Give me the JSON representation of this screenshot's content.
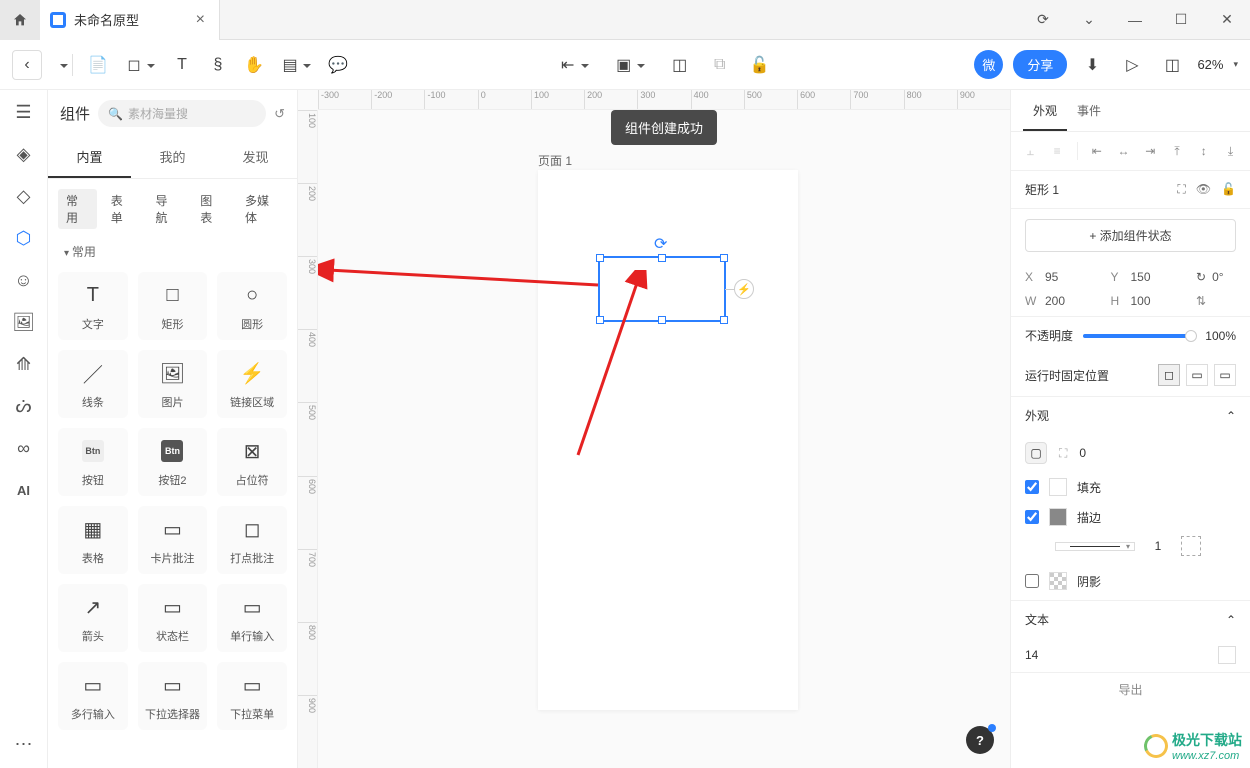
{
  "titlebar": {
    "tab_title": "未命名原型"
  },
  "toolbar": {
    "share_label": "分享",
    "micro_label": "微",
    "zoom_label": "62%"
  },
  "left_panel": {
    "title": "组件",
    "search_placeholder": "素材海量搜",
    "tabs": [
      "内置",
      "我的",
      "发现"
    ],
    "categories": [
      "常用",
      "表单",
      "导航",
      "图表",
      "多媒体"
    ],
    "section_label": "常用",
    "items": [
      {
        "label": "文字",
        "icon": "T"
      },
      {
        "label": "矩形",
        "icon": "□"
      },
      {
        "label": "圆形",
        "icon": "○"
      },
      {
        "label": "线条",
        "icon": "／"
      },
      {
        "label": "图片",
        "icon": "🖼"
      },
      {
        "label": "链接区域",
        "icon": "⚡"
      },
      {
        "label": "按钮",
        "icon": "Btn"
      },
      {
        "label": "按钮2",
        "icon": "Btn"
      },
      {
        "label": "占位符",
        "icon": "⊠"
      },
      {
        "label": "表格",
        "icon": "▦"
      },
      {
        "label": "卡片批注",
        "icon": "▭"
      },
      {
        "label": "打点批注",
        "icon": "◻"
      },
      {
        "label": "箭头",
        "icon": "↗"
      },
      {
        "label": "状态栏",
        "icon": "▭"
      },
      {
        "label": "单行输入",
        "icon": "▭"
      },
      {
        "label": "多行输入",
        "icon": "▭"
      },
      {
        "label": "下拉选择器",
        "icon": "▭"
      },
      {
        "label": "下拉菜单",
        "icon": "▭"
      }
    ]
  },
  "canvas": {
    "page_label": "页面 1",
    "toast_message": "组件创建成功",
    "ruler_h": [
      "-300",
      "-200",
      "-100",
      "0",
      "100",
      "200",
      "300",
      "400",
      "500",
      "600",
      "700",
      "800",
      "900"
    ],
    "ruler_v": [
      "100",
      "200",
      "300",
      "400",
      "500",
      "600",
      "700",
      "800",
      "900"
    ]
  },
  "right_panel": {
    "tabs": [
      "外观",
      "事件"
    ],
    "element_name": "矩形 1",
    "add_state_label": "+ 添加组件状态",
    "x_label": "X",
    "x_value": "95",
    "y_label": "Y",
    "y_value": "150",
    "w_label": "W",
    "w_value": "200",
    "h_label": "H",
    "h_value": "100",
    "rotation_value": "0°",
    "opacity_label": "不透明度",
    "opacity_value": "100%",
    "fixed_label": "运行时固定位置",
    "appearance_label": "外观",
    "corner_value": "0",
    "fill_label": "填充",
    "stroke_label": "描边",
    "stroke_width": "1",
    "shadow_label": "阴影",
    "text_label": "文本",
    "font_size": "14",
    "export_label": "导出"
  },
  "watermark": {
    "site_cn": "极光下载站",
    "site_url": "www.xz7.com"
  }
}
